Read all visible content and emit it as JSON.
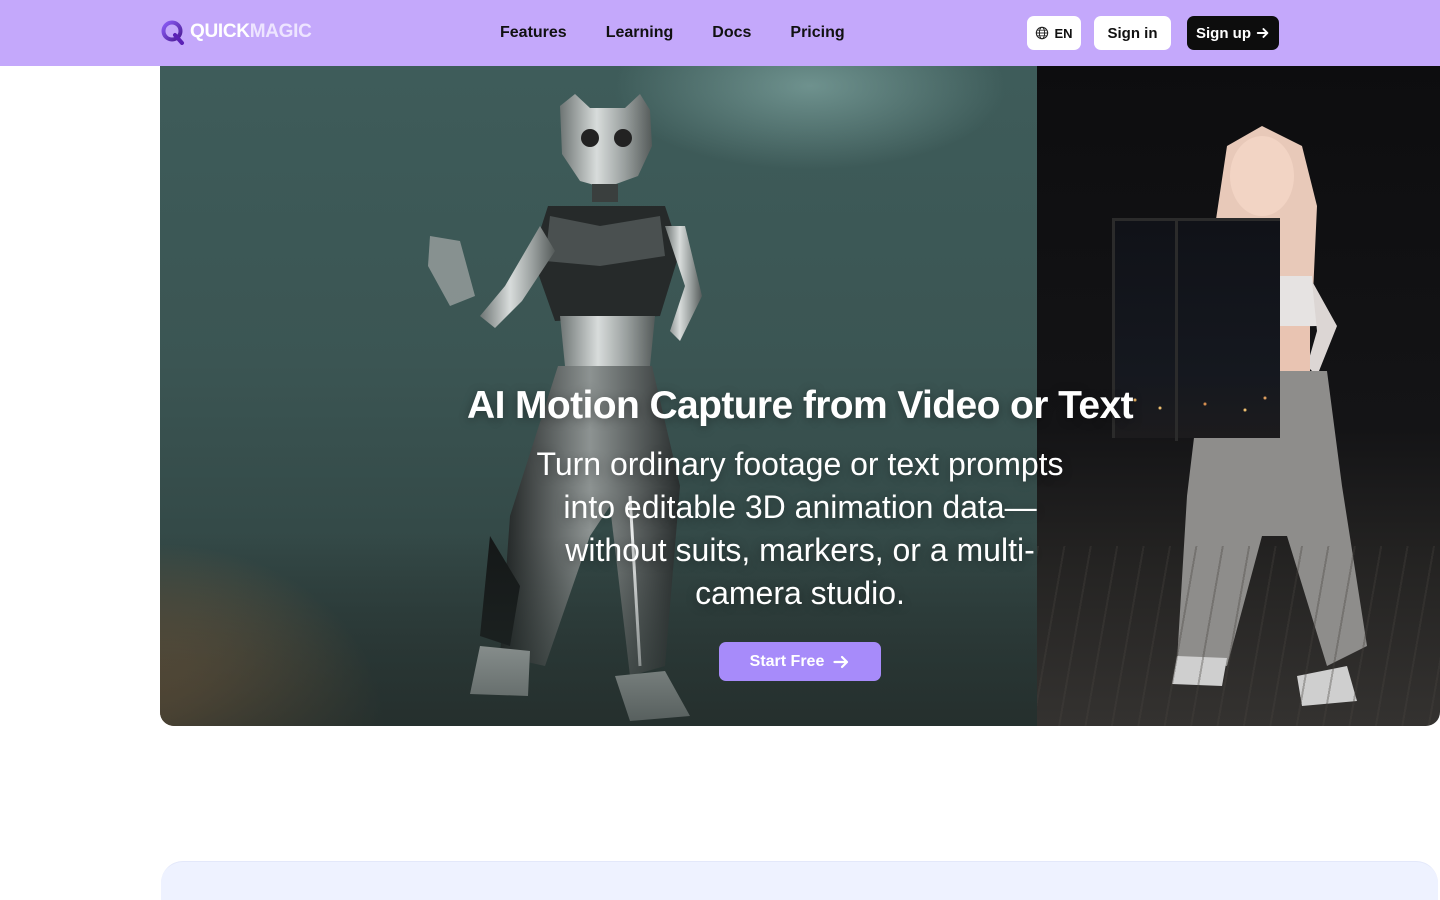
{
  "brand": {
    "logo_word1": "QUICK",
    "logo_word2": "MAGIC",
    "accent_color": "#c4a8fb",
    "button_color": "#a78bfa"
  },
  "nav": {
    "links": [
      {
        "label": "Features"
      },
      {
        "label": "Learning"
      },
      {
        "label": "Docs"
      },
      {
        "label": "Pricing"
      }
    ],
    "language": {
      "label": "EN",
      "icon": "globe-icon"
    },
    "sign_in": "Sign in",
    "sign_up": {
      "label": "Sign up",
      "icon": "arrow-right-icon"
    }
  },
  "hero": {
    "title": "AI Motion Capture from Video or Text",
    "subtitle": "Turn ordinary footage or text prompts into editable 3D animation data—without suits, markers, or a multi-camera studio.",
    "cta": {
      "label": "Start Free",
      "icon": "arrow-right-icon"
    },
    "media": {
      "left": "3d-robot-cat-character",
      "right": "dancing-person-video"
    }
  }
}
